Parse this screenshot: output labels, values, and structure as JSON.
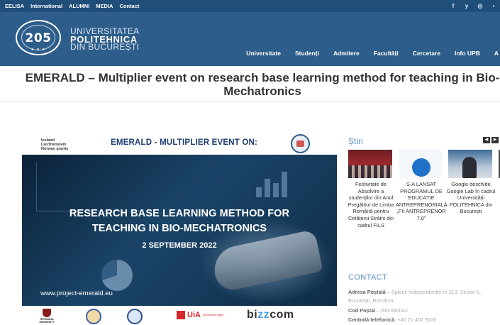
{
  "topbar": {
    "links": [
      "EELISA",
      "International",
      "ALUMNI",
      "MEDIA",
      "Contact"
    ],
    "social_icons": [
      "facebook-icon",
      "twitter-icon",
      "instagram-icon",
      "youtube-icon"
    ],
    "social_glyphs": [
      "f",
      "y",
      "◎",
      "▪"
    ]
  },
  "header": {
    "logo_number": "205",
    "logo_stars": "★ ★ ★",
    "uni_line1": "UNIVERSITATEA",
    "uni_line2": "POLITEHNICA",
    "uni_line3": "DIN BUCUREȘTI",
    "nav": [
      "Universitate",
      "Studenți",
      "Admitere",
      "Facultăți",
      "Cercetare",
      "Info UPB",
      "A"
    ]
  },
  "article": {
    "title": "EMERALD – Multiplier event on research base learning method for teaching in Bio-Mechatronics"
  },
  "poster": {
    "grants": "Iceland\nLiechtenstein\nNorway grants",
    "heading": "EMERALD - MULTIPLIER EVENT ON:",
    "line1": "RESEARCH BASE LEARNING METHOD FOR",
    "line2": "TEACHING IN BIO-MECHATRONICS",
    "date": "2 SEPTEMBER 2022",
    "site": "www.project-emerald.eu",
    "partner_tu": "TECHNICAL UNIVERSITY",
    "partner_uia": "UiA",
    "partner_uia_sub": "University of Agder",
    "partner_bizz_a": "bi",
    "partner_bizz_b": "zz",
    "partner_bizz_c": "com"
  },
  "sidebar": {
    "news_title": "Știri",
    "prev": "◀",
    "next": "▶",
    "news": [
      {
        "caption": "Festivitate de Absolvire a studenților din Anul Pregătitor de Limba Română pentru Cetățenii Străini din cadrul FILS"
      },
      {
        "caption": "S-A LANSAT PROGRAMUL DE EDUCAȚIE ANTREPRENORIALĂ „FII ANTREPRENOR 7.0”"
      },
      {
        "caption": "Google deschide Google Lab în cadrul Universității POLITEHNICA din București"
      }
    ],
    "contact_title": "CONTACT",
    "postal_label": "Adresa Poștală",
    "postal_value": " – Splaiul Independenței nr 313, Sector 6, București, România",
    "postcode_label": "Cod Poștal",
    "postcode_value": " – RO-060042",
    "phone_label": "Centrală telefonică",
    "phone_value": ": +40 21 402 9100"
  },
  "colors": {
    "topbar": "#1f4e79",
    "header": "#2d5d8a",
    "accent": "#5a8fc4"
  }
}
